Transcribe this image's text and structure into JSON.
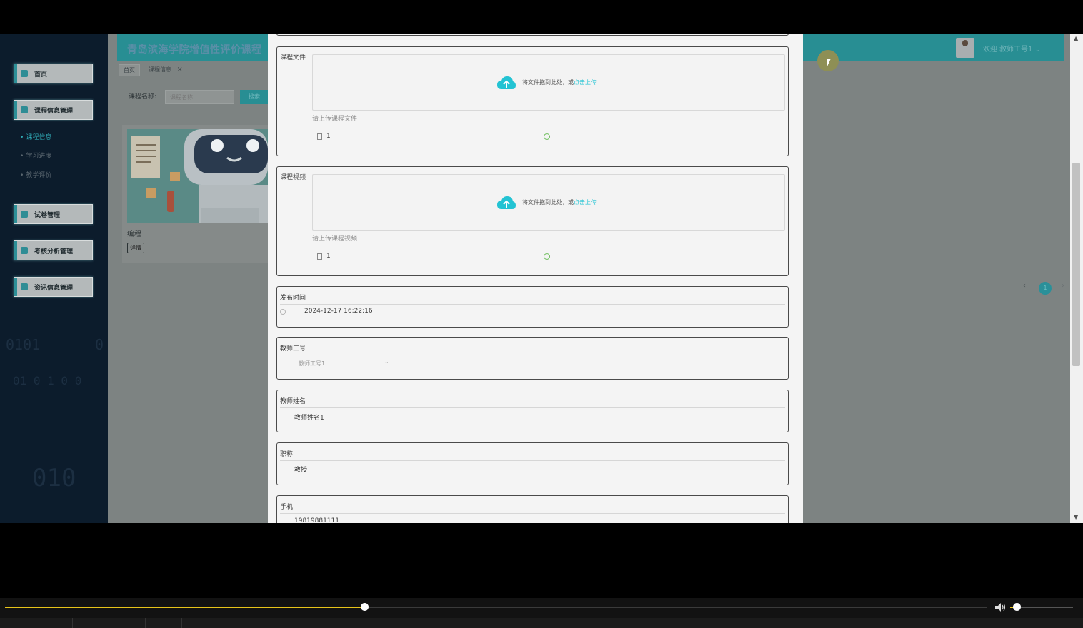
{
  "sidebar": {
    "menu": [
      {
        "label": "首页",
        "icon": "home-icon"
      },
      {
        "label": "课程信息管理",
        "icon": "course-icon"
      },
      {
        "label": "试卷管理",
        "icon": "exam-icon"
      },
      {
        "label": "考核分析管理",
        "icon": "analysis-icon"
      },
      {
        "label": "资讯信息管理",
        "icon": "news-icon"
      }
    ],
    "submenu": [
      {
        "label": "课程信息",
        "active": true
      },
      {
        "label": "学习进度",
        "active": false
      },
      {
        "label": "教学评价",
        "active": false
      }
    ],
    "bg_text": [
      "0101",
      "0",
      "01 0 1 0 0",
      "010"
    ]
  },
  "header": {
    "title": "青岛滨海学院增值性评价课程",
    "welcome": "欢迎 教师工号1",
    "dropdown_icon": "chevron-down-icon",
    "accent": "#288e93"
  },
  "tabs": [
    {
      "label": "首页"
    },
    {
      "label": "课程信息",
      "close": "×"
    }
  ],
  "search": {
    "label": "课程名称:",
    "placeholder": "课程名称",
    "button": "搜索"
  },
  "course_card": {
    "title": "编程",
    "button": "详情"
  },
  "pager": {
    "prev": "‹",
    "current": "1",
    "next": "›"
  },
  "dialog": {
    "file_section": {
      "legend": "课程文件",
      "drop_text": "将文件拖到此处，或",
      "drop_link": "点击上传",
      "hint": "请上传课程文件",
      "file_name": "1"
    },
    "video_section": {
      "legend": "课程视频",
      "drop_text": "将文件拖到此处，或",
      "drop_link": "点击上传",
      "hint": "请上传课程视频",
      "file_name": "1"
    },
    "publish_time": {
      "legend": "发布时间",
      "value": "2024-12-17 16:22:16"
    },
    "teacher_id": {
      "legend": "教师工号",
      "value": "教师工号1"
    },
    "teacher_name": {
      "legend": "教师姓名",
      "value": "教师姓名1"
    },
    "title_field": {
      "legend": "职称",
      "value": "教授"
    },
    "phone": {
      "legend": "手机",
      "value": "19819881111"
    }
  },
  "player": {
    "progress": 0.366,
    "volume": 0.1,
    "progress_color": "#e7c41a"
  }
}
